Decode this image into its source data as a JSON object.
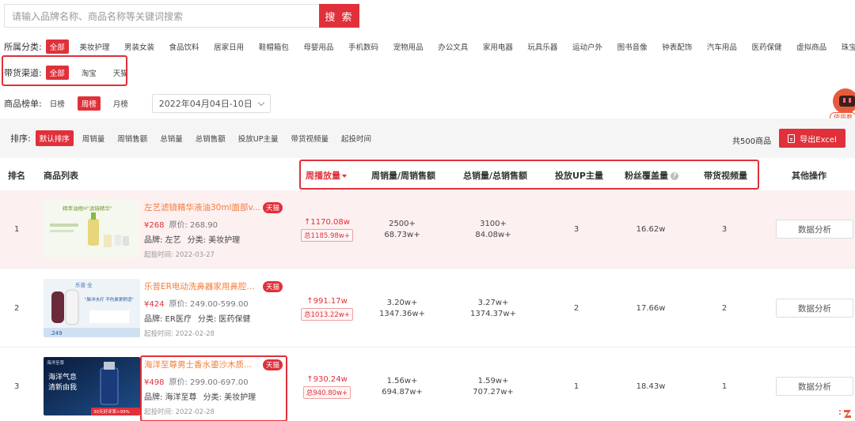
{
  "search": {
    "placeholder": "请输入品牌名称、商品名称等关键词搜索",
    "button": "搜 索"
  },
  "categories": {
    "label": "所属分类:",
    "items": [
      "全部",
      "美妆护理",
      "男装女装",
      "食品饮料",
      "居家日用",
      "鞋帽箱包",
      "母婴用品",
      "手机数码",
      "宠物用品",
      "办公文具",
      "家用电器",
      "玩具乐器",
      "运动户外",
      "图书音像",
      "钟表配饰",
      "汽车用品",
      "医药保健",
      "虚拟商品",
      "珠宝饰品"
    ]
  },
  "channels": {
    "label": "带货渠道:",
    "items": [
      "全部",
      "淘宝",
      "天猫"
    ]
  },
  "ranking": {
    "label": "商品榜单:",
    "items": [
      "日榜",
      "周榜",
      "月榜"
    ],
    "date": "2022年04月04日-10日"
  },
  "robot": {
    "label": "使用教"
  },
  "sort": {
    "label": "排序:",
    "items": [
      "默认排序",
      "周销量",
      "周销售额",
      "总销量",
      "总销售额",
      "投放UP主量",
      "带货视频量",
      "起投时间"
    ],
    "total": "共500商品",
    "export": "导出Excel"
  },
  "table": {
    "headers": {
      "rank": "排名",
      "product": "商品列表",
      "play": "周播放量",
      "weekly": "周销量/周销售额",
      "total": "总销量/总销售额",
      "up": "投放UP主量",
      "fans": "粉丝覆盖量",
      "videos": "带货视频量",
      "ops": "其他操作"
    },
    "rows": [
      {
        "rank": "1",
        "name": "左艺滤镜精华液油30ml面部v...",
        "tag": "天猫",
        "price": "¥268",
        "orig": "原价: 268.90",
        "brand": "品牌: 左艺",
        "category": "分类: 美妆护理",
        "date": "起投时间: 2022-03-27",
        "play": "↑1170.08w",
        "play_total": "总1185.98w+",
        "weekly_qty": "2500+",
        "weekly_amt": "68.73w+",
        "total_qty": "3100+",
        "total_amt": "84.08w+",
        "up": "3",
        "fans": "16.62w",
        "videos": "3",
        "action": "数据分析"
      },
      {
        "rank": "2",
        "name": "乐普ER电动洗鼻器家用鼻腔...",
        "tag": "天猫",
        "price": "¥424",
        "orig": "原价: 249.00-599.00",
        "brand": "品牌: ER医疗",
        "category": "分类: 医药保健",
        "date": "起投时间: 2022-02-28",
        "play": "↑991.17w",
        "play_total": "总1013.22w+",
        "weekly_qty": "3.20w+",
        "weekly_amt": "1347.36w+",
        "total_qty": "3.27w+",
        "total_amt": "1374.37w+",
        "up": "2",
        "fans": "17.66w",
        "videos": "2",
        "action": "数据分析"
      },
      {
        "rank": "3",
        "name": "海洋至尊男士香水鎏沙木质...",
        "tag": "天猫",
        "price": "¥498",
        "orig": "原价: 299.00-697.00",
        "brand": "品牌: 海洋至尊",
        "category": "分类: 美妆护理",
        "date": "起投时间: 2022-02-28",
        "play": "↑930.24w",
        "play_total": "总940.80w+",
        "weekly_qty": "1.56w+",
        "weekly_amt": "694.87w+",
        "total_qty": "1.59w+",
        "total_amt": "707.27w+",
        "up": "1",
        "fans": "18.43w",
        "videos": "1",
        "action": "数据分析"
      }
    ]
  },
  "thumbs": {
    "t1": "精萃油橙H\"滤镜精华\"",
    "t2a": "乐普·全",
    "t2b": "\"脉冲水疗 不伤鼻更舒适\"",
    "t2c": ".249",
    "t3a": "海洋至尊",
    "t3b": "海洋气息",
    "t3c": "清新由我",
    "t3d": "30天好评率>99%"
  },
  "colors": {
    "accent": "#e0303a",
    "orange": "#f57c3a",
    "highlight_row": "#fdf0f0"
  }
}
